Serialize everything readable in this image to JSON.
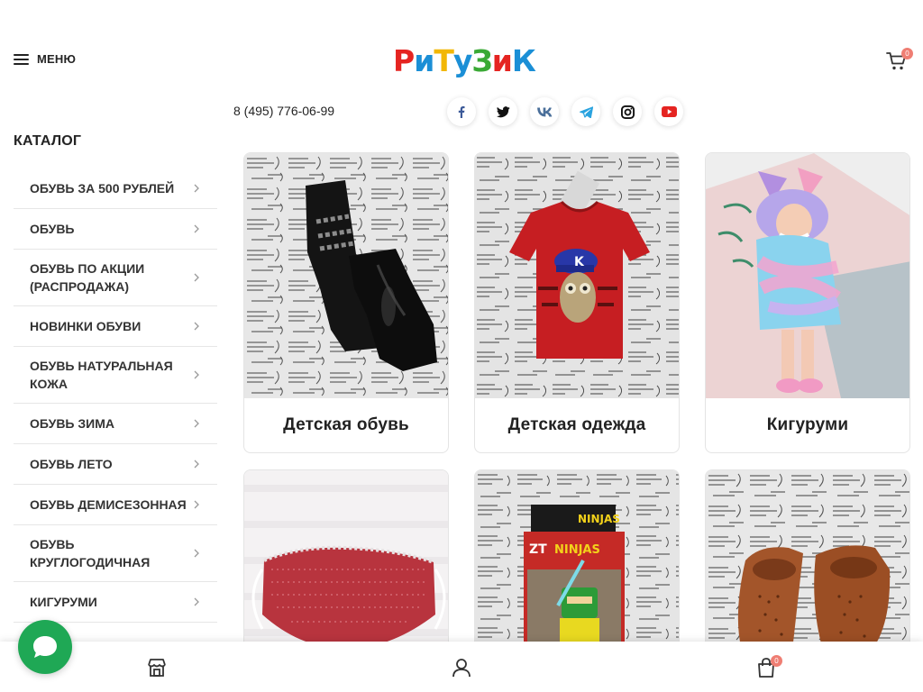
{
  "header": {
    "menu_label": "МЕНЮ",
    "logo_text": "РиТуЗиК",
    "logo_colors": [
      "#e52421",
      "#1b8fd6",
      "#f2b705",
      "#1b8fd6",
      "#3aa935",
      "#e52421",
      "#1b8fd6"
    ],
    "cart_count": "0",
    "accent": "#ef7e73"
  },
  "contacts": {
    "phone": "8 (495) 776-06-99",
    "socials": [
      {
        "icon": "facebook-icon",
        "color": "#3b5998"
      },
      {
        "icon": "twitter-icon",
        "color": "#111111"
      },
      {
        "icon": "vk-icon",
        "color": "#4a6f9a"
      },
      {
        "icon": "telegram-icon",
        "color": "#2aa3df"
      },
      {
        "icon": "instagram-icon",
        "color": "#111111"
      },
      {
        "icon": "youtube-icon",
        "color": "#e52421"
      }
    ]
  },
  "sidebar": {
    "title": "КАТАЛОГ",
    "items": [
      {
        "label": "ОБУВЬ ЗА 500 РУБЛЕЙ"
      },
      {
        "label": "ОБУВЬ"
      },
      {
        "label": "ОБУВЬ ПО АКЦИИ (РАСПРОДАЖА)"
      },
      {
        "label": "НОВИНКИ ОБУВИ"
      },
      {
        "label": "ОБУВЬ НАТУРАЛЬНАЯ КОЖА"
      },
      {
        "label": "ОБУВЬ ЗИМА"
      },
      {
        "label": "ОБУВЬ ЛЕТО"
      },
      {
        "label": "ОБУВЬ ДЕМИСЕЗОННАЯ"
      },
      {
        "label": "ОБУВЬ КРУГЛОГОДИЧНАЯ"
      },
      {
        "label": "КИГУРУМИ"
      }
    ]
  },
  "categories": [
    {
      "title": "Детская обувь"
    },
    {
      "title": "Детская одежда"
    },
    {
      "title": "Кигуруми"
    },
    {
      "title": ""
    },
    {
      "title": ""
    },
    {
      "title": ""
    }
  ],
  "bottom_nav": {
    "items": [
      "store-icon",
      "user-icon",
      "cart-icon"
    ],
    "cart_count": "0"
  },
  "chat": {
    "color": "#1fa855"
  }
}
